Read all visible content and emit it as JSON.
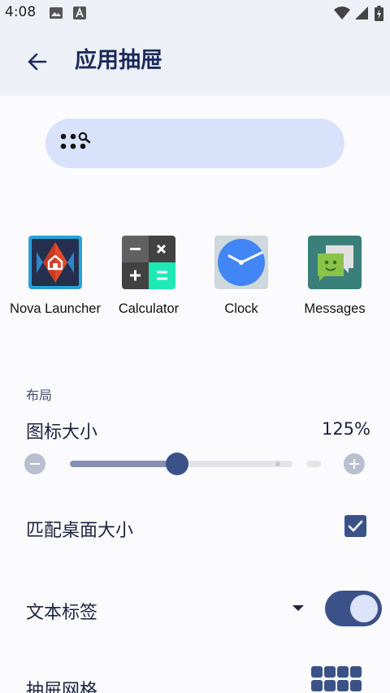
{
  "status_bar": {
    "time": "4:08"
  },
  "header": {
    "title": "应用抽屉"
  },
  "apps": [
    {
      "label": "Nova Launcher",
      "icon": "nova-launcher-icon"
    },
    {
      "label": "Calculator",
      "icon": "calculator-icon"
    },
    {
      "label": "Clock",
      "icon": "clock-icon"
    },
    {
      "label": "Messages",
      "icon": "messages-icon"
    }
  ],
  "layout": {
    "section_title": "布局",
    "icon_size": {
      "label": "图标大小",
      "value_text": "125%",
      "slider_fraction": 0.48
    },
    "match_desktop_size": {
      "label": "匹配桌面大小",
      "checked": true
    },
    "text_labels": {
      "label": "文本标签",
      "enabled": true
    },
    "drawer_grid": {
      "label": "抽屉网格"
    }
  },
  "colors": {
    "accent": "#3b5289",
    "search_bg": "#d9e2fb",
    "header_bg": "#eef0f8"
  }
}
